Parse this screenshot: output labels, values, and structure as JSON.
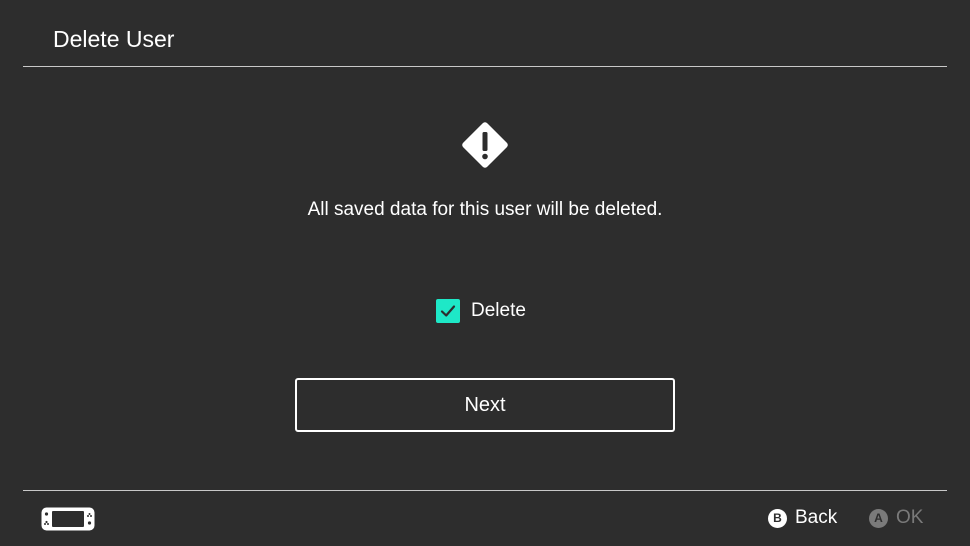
{
  "header": {
    "title": "Delete User"
  },
  "main": {
    "warning_icon": "warning-diamond-icon",
    "message": "All saved data for this user will be deleted.",
    "checkbox": {
      "label": "Delete",
      "checked": true,
      "color": "#1ee8c7"
    },
    "next_label": "Next"
  },
  "footer": {
    "console_icon": "handheld-console-icon",
    "back": {
      "glyph": "B",
      "label": "Back"
    },
    "ok": {
      "glyph": "A",
      "label": "OK",
      "disabled": true
    }
  },
  "colors": {
    "background": "#2d2d2d",
    "text": "#ffffff",
    "accent": "#1ee8c7",
    "disabled": "#7a7a7a"
  }
}
